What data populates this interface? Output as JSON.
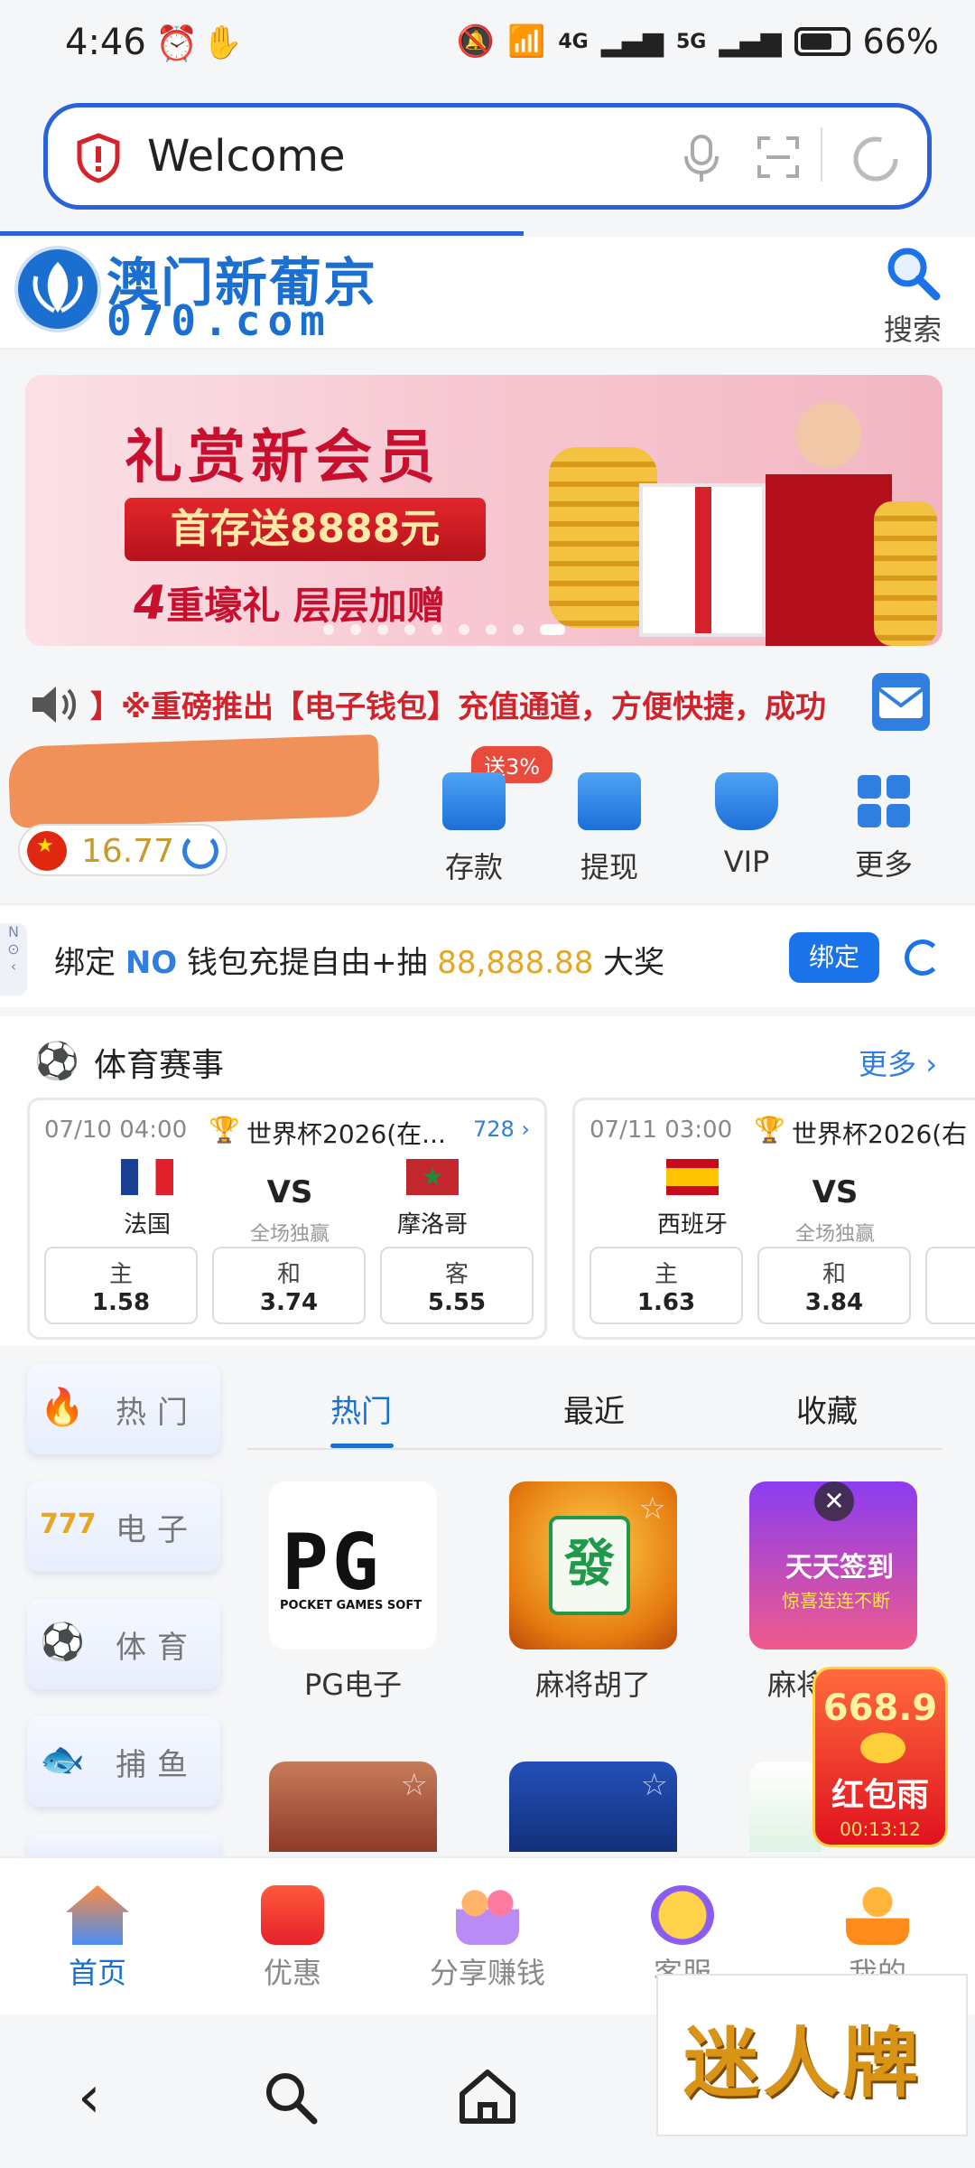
{
  "status_bar": {
    "time": "4:46",
    "battery": "66%",
    "signal_4g": "4G",
    "signal_5g": "5G"
  },
  "browser": {
    "url_title": "Welcome"
  },
  "site": {
    "logo_cn": "澳门新葡京",
    "logo_en": "070.com",
    "search_label": "搜索"
  },
  "banner": {
    "title": "礼赏新会员",
    "ribbon": "首存送8888元",
    "subtitle_num": "4",
    "subtitle": "重壕礼 层层加赠",
    "slide_count": 9,
    "active_slide": 9
  },
  "marquee": {
    "text": "】※重磅推出【电子钱包】充值通道，方便快捷，成功"
  },
  "account": {
    "balance": "16.77",
    "deposit_badge": "送3%",
    "actions": [
      {
        "label": "存款"
      },
      {
        "label": "提现"
      },
      {
        "label": "VIP"
      },
      {
        "label": "更多"
      }
    ]
  },
  "bind_bar": {
    "prefix": "绑定 ",
    "brand": "NO",
    "middle": " 钱包充提自由+抽 ",
    "amount": "88,888.88",
    "suffix": " 大奖",
    "button": "绑定"
  },
  "sports": {
    "title": "体育赛事",
    "more": "更多",
    "matches": [
      {
        "time": "07/10 04:00",
        "league": "世界杯2026(在...",
        "count": "728",
        "home": "法国",
        "away": "摩洛哥",
        "vs": "VS",
        "market": "全场独赢",
        "odds": [
          {
            "label": "主",
            "value": "1.58"
          },
          {
            "label": "和",
            "value": "3.74"
          },
          {
            "label": "客",
            "value": "5.55"
          }
        ]
      },
      {
        "time": "07/11 03:00",
        "league": "世界杯2026(右",
        "home": "西班牙",
        "vs": "VS",
        "market": "全场独赢",
        "odds": [
          {
            "label": "主",
            "value": "1.63"
          },
          {
            "label": "和",
            "value": "3.84"
          }
        ]
      }
    ]
  },
  "categories": [
    {
      "label": "热门",
      "icon": "flame-icon"
    },
    {
      "label": "电子",
      "icon": "slot-777-icon"
    },
    {
      "label": "体育",
      "icon": "soccer-ball-icon"
    },
    {
      "label": "捕鱼",
      "icon": "fish-icon"
    }
  ],
  "game_tabs": [
    {
      "label": "热门"
    },
    {
      "label": "最近"
    },
    {
      "label": "收藏"
    }
  ],
  "games": [
    {
      "label": "PG电子",
      "logo_text": "PG",
      "logo_sub": "POCKET GAMES SOFT"
    },
    {
      "label": "麻将胡了",
      "tile": "發"
    },
    {
      "label": "麻将胡",
      "promo_text": "天天签到",
      "promo_sub": "惊喜连连不断"
    }
  ],
  "red_envelope": {
    "amount": "668.9",
    "label": "红包雨",
    "timer": "00:13:12"
  },
  "bottom_nav": [
    {
      "label": "首页"
    },
    {
      "label": "优惠"
    },
    {
      "label": "分享赚钱"
    },
    {
      "label": "客服"
    },
    {
      "label": "我的"
    }
  ],
  "watermark": {
    "text": "迷人牌"
  },
  "colors": {
    "accent": "#1a6fd0",
    "url_border": "#2a62d9",
    "marquee_red": "#d0232b",
    "gold": "#e6a623"
  }
}
